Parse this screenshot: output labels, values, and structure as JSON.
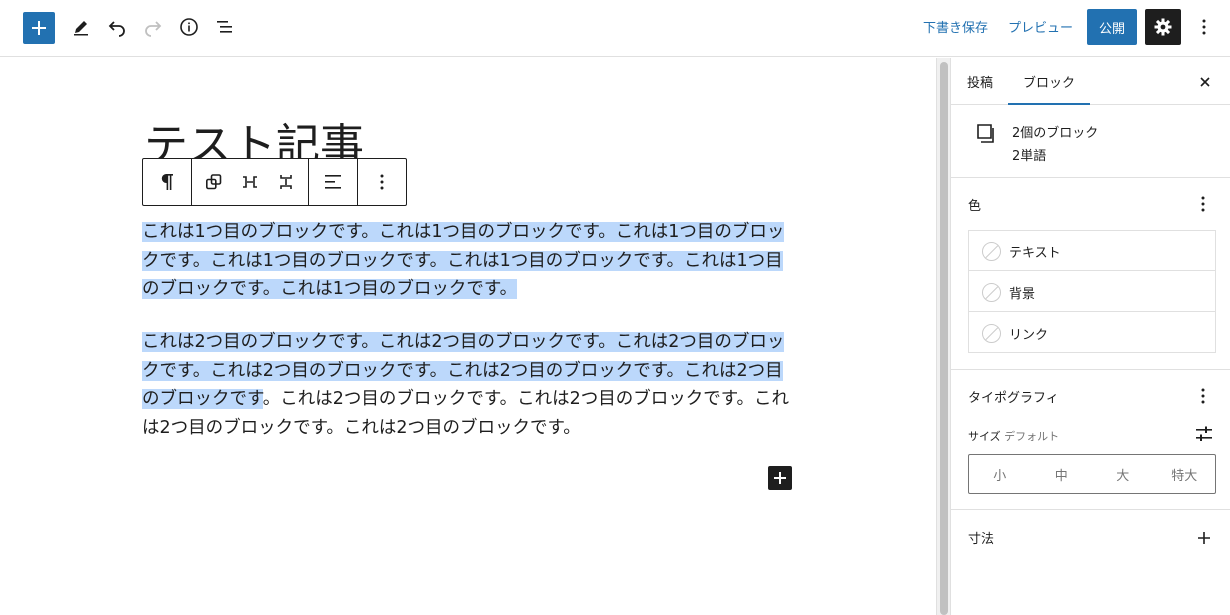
{
  "toolbar": {
    "save_draft": "下書き保存",
    "preview": "プレビュー",
    "publish": "公開"
  },
  "editor": {
    "title": "テスト記事",
    "paragraphs": [
      {
        "selected": "これは1つ目のブロックです。これは1つ目のブロックです。これは1つ目のブロックです。これは1つ目のブロックです。これは1つ目のブロックです。これは1つ目のブロックです。これは1つ目のブロックです。",
        "rest": ""
      },
      {
        "selected": "これは2つ目のブロックです。これは2つ目のブロックです。これは2つ目のブロックです。これは2つ目のブロックです。これは2つ目のブロックです。これは2つ目のブロックです",
        "rest": "。これは2つ目のブロックです。これは2つ目のブロックです。これは2つ目のブロックです。これは2つ目のブロックです。"
      }
    ]
  },
  "sidebar": {
    "tabs": [
      "投稿",
      "ブロック"
    ],
    "active_tab": "ブロック",
    "block_info": {
      "title": "2個のブロック",
      "count": "2単語"
    },
    "color": {
      "title": "色",
      "items": [
        "テキスト",
        "背景",
        "リンク"
      ]
    },
    "typography": {
      "title": "タイポグラフィ",
      "size_label": "サイズ",
      "size_value": "デフォルト",
      "sizes": [
        "小",
        "中",
        "大",
        "特大"
      ]
    },
    "dimensions": {
      "title": "寸法"
    }
  },
  "colors": {
    "accent": "#2271b1",
    "selection": "#bcd8fb",
    "dark": "#1e1e1e"
  }
}
